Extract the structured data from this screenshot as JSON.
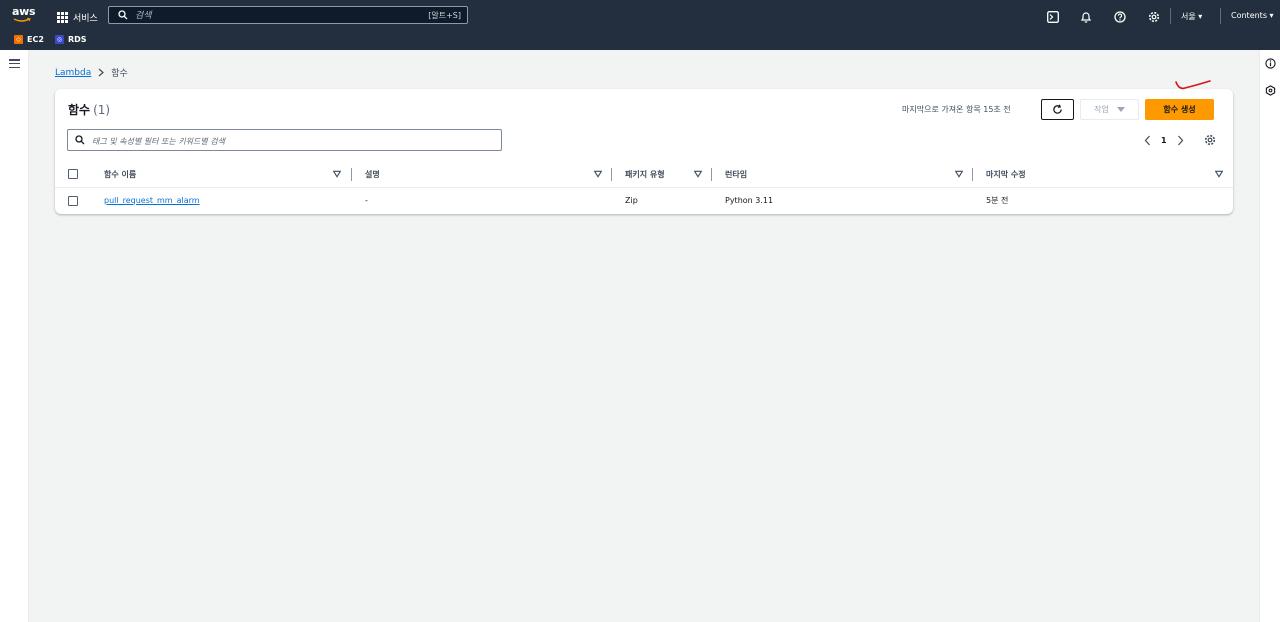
{
  "nav": {
    "logo": "aws",
    "services_label": "서비스",
    "search_placeholder": "검색",
    "search_shortcut": "[알트+S]",
    "region": "서울 ▾",
    "account": "Contents ▾",
    "favorites": [
      {
        "label": "EC2",
        "color": "#ed7100"
      },
      {
        "label": "RDS",
        "color": "#3b48cc"
      }
    ]
  },
  "breadcrumb": {
    "link": "Lambda",
    "current": "함수"
  },
  "panel": {
    "title": "함수",
    "count": "(1)",
    "last_fetched": "마지막으로 가져온 항목 15초 전",
    "actions_label": "작업",
    "create_label": "함수 생성",
    "filter_placeholder": "태그 및 속성별 필터 또는 키워드별 검색",
    "page": "1"
  },
  "table": {
    "columns": [
      "함수 이름",
      "설명",
      "패키지 유형",
      "런타임",
      "마지막 수정"
    ],
    "rows": [
      {
        "name": "pull_request_mm_alarm",
        "description": "-",
        "package_type": "Zip",
        "runtime": "Python 3.11",
        "modified": "5분 전"
      }
    ]
  },
  "colors": {
    "nav_bg": "#232f3e",
    "primary_button": "#ff9900",
    "link": "#0972d3",
    "annotation": "#d91515"
  }
}
